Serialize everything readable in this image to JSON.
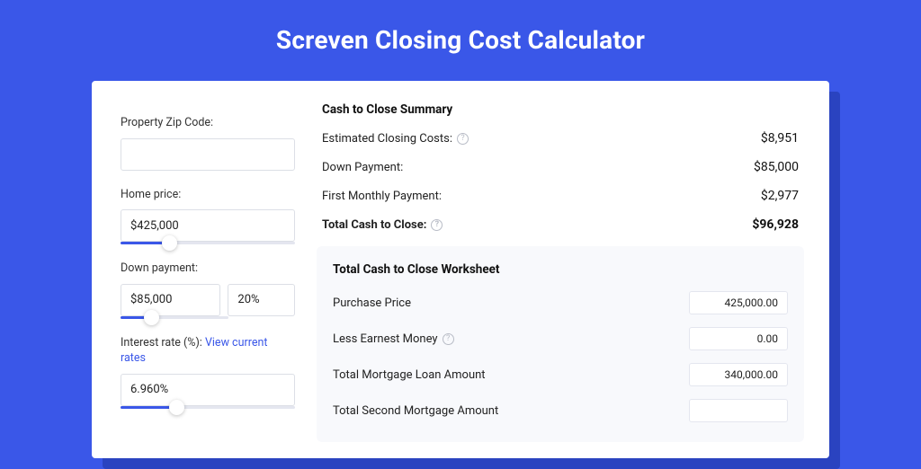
{
  "title": "Screven Closing Cost Calculator",
  "left": {
    "zip_label": "Property Zip Code:",
    "zip_value": "",
    "home_price_label": "Home price:",
    "home_price_value": "$425,000",
    "home_price_slider_pct": 28,
    "down_payment_label": "Down payment:",
    "down_payment_value": "$85,000",
    "down_payment_pct_value": "20%",
    "down_payment_slider_pct": 28,
    "interest_label_prefix": "Interest rate (%): ",
    "interest_link_text": "View current rates",
    "interest_value": "6.960%",
    "interest_slider_pct": 32
  },
  "summary": {
    "title": "Cash to Close Summary",
    "rows": [
      {
        "label": "Estimated Closing Costs:",
        "help": true,
        "value": "$8,951",
        "bold": false
      },
      {
        "label": "Down Payment:",
        "help": false,
        "value": "$85,000",
        "bold": false
      },
      {
        "label": "First Monthly Payment:",
        "help": false,
        "value": "$2,977",
        "bold": false
      },
      {
        "label": "Total Cash to Close:",
        "help": true,
        "value": "$96,928",
        "bold": true
      }
    ]
  },
  "worksheet": {
    "title": "Total Cash to Close Worksheet",
    "rows": [
      {
        "label": "Purchase Price",
        "help": false,
        "value": "425,000.00"
      },
      {
        "label": "Less Earnest Money",
        "help": true,
        "value": "0.00"
      },
      {
        "label": "Total Mortgage Loan Amount",
        "help": false,
        "value": "340,000.00"
      },
      {
        "label": "Total Second Mortgage Amount",
        "help": false,
        "value": ""
      }
    ]
  }
}
